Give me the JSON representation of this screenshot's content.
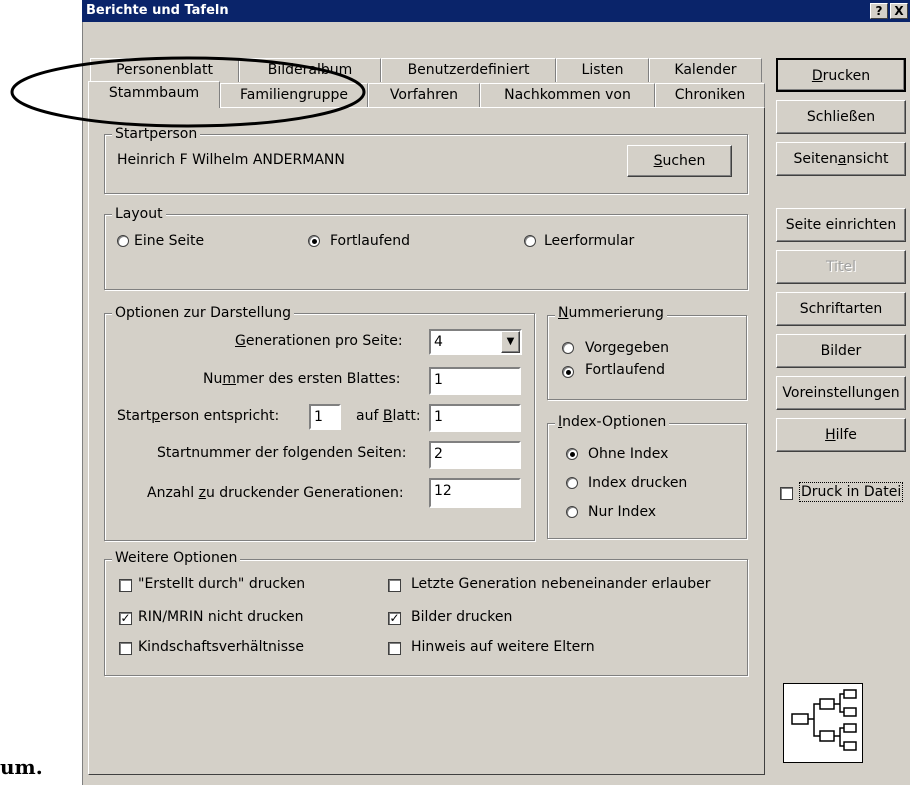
{
  "window": {
    "title": "Berichte und Tafeln",
    "help_btn": "?",
    "close_btn": "X"
  },
  "caption_fragment": "um.",
  "tabs_row1": [
    "Personenblatt",
    "Bilderalbum",
    "Benutzerdefiniert",
    "Listen",
    "Kalender"
  ],
  "tabs_row2": [
    "Stammbaum",
    "Familiengruppe",
    "Vorfahren",
    "Nachkommen von",
    "Chroniken"
  ],
  "active_tab": "Stammbaum",
  "startperson": {
    "label": "Startperson",
    "name": "Heinrich F Wilhelm ANDERMANN",
    "search_btn": "Suchen"
  },
  "layout": {
    "label": "Layout",
    "options": [
      "Eine Seite",
      "Fortlaufend",
      "Leerformular"
    ],
    "selected": "Fortlaufend"
  },
  "darstellung": {
    "label": "Optionen zur Darstellung",
    "gen_label": "Generationen pro Seite:",
    "gen_value": "4",
    "first_sheet_label": "Nummer des ersten Blattes:",
    "first_sheet_value": "1",
    "startperson_label": "Startperson entspricht:",
    "startperson_value": "1",
    "blatt_label": "auf Blatt:",
    "blatt_value": "1",
    "startnum_label": "Startnummer der folgenden Seiten:",
    "startnum_value": "2",
    "anzahl_label": "Anzahl zu druckender Generationen:",
    "anzahl_value": "12"
  },
  "nummerierung": {
    "label": "Nummerierung",
    "options": [
      "Vorgegeben",
      "Fortlaufend"
    ],
    "selected": "Fortlaufend"
  },
  "index": {
    "label": "Index-Optionen",
    "options": [
      "Ohne Index",
      "Index drucken",
      "Nur Index"
    ],
    "selected": "Ohne Index"
  },
  "weitere": {
    "label": "Weitere Optionen",
    "options": [
      {
        "label": "\"Erstellt durch\" drucken",
        "checked": false
      },
      {
        "label": "Letzte Generation nebeneinander erlauber",
        "checked": false
      },
      {
        "label": "RIN/MRIN nicht drucken",
        "checked": true
      },
      {
        "label": "Bilder drucken",
        "checked": true
      },
      {
        "label": "Kindschaftsverhältnisse",
        "checked": false
      },
      {
        "label": "Hinweis auf weitere Eltern",
        "checked": false
      }
    ]
  },
  "side_buttons": [
    "Drucken",
    "Schließen",
    "Seitenansicht",
    "Seite einrichten",
    "Titel",
    "Schriftarten",
    "Bilder",
    "Voreinstellungen",
    "Hilfe"
  ],
  "druck_in_datei": {
    "label": "Druck in Datei",
    "checked": false
  },
  "colors": {
    "titlebar": "#0a246a",
    "face": "#d4d0c8"
  },
  "icons": {
    "pedigree": "pedigree-chart-icon"
  }
}
